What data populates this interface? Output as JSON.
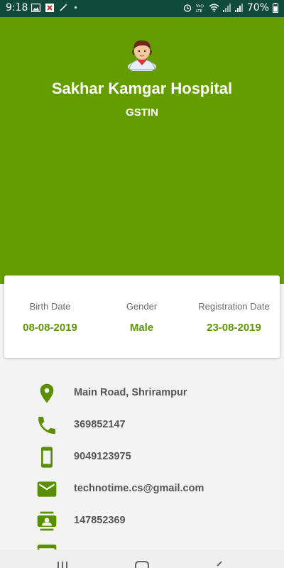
{
  "status_bar": {
    "time": "9:18",
    "battery": "70%",
    "colors": {
      "background": "#0f4a3a"
    }
  },
  "profile": {
    "name": "Sakhar Kamgar Hospital",
    "gstin_label": "GSTIN"
  },
  "info_card": {
    "columns": [
      {
        "label": "Birth Date",
        "value": "08-08-2019"
      },
      {
        "label": "Gender",
        "value": "Male"
      },
      {
        "label": "Registration Date",
        "value": "23-08-2019"
      }
    ]
  },
  "details": [
    {
      "icon": "location-pin-icon",
      "text": "Main Road, Shrirampur"
    },
    {
      "icon": "phone-icon",
      "text": "369852147"
    },
    {
      "icon": "mobile-phone-icon",
      "text": "9049123975"
    },
    {
      "icon": "email-icon",
      "text": "technotime.cs@gmail.com"
    },
    {
      "icon": "contact-card-icon",
      "text": "147852369"
    },
    {
      "icon": "card-icon",
      "text": ""
    }
  ],
  "colors": {
    "header": "#659c00",
    "accent_text": "#5f9608",
    "icon": "#5a8f00"
  }
}
